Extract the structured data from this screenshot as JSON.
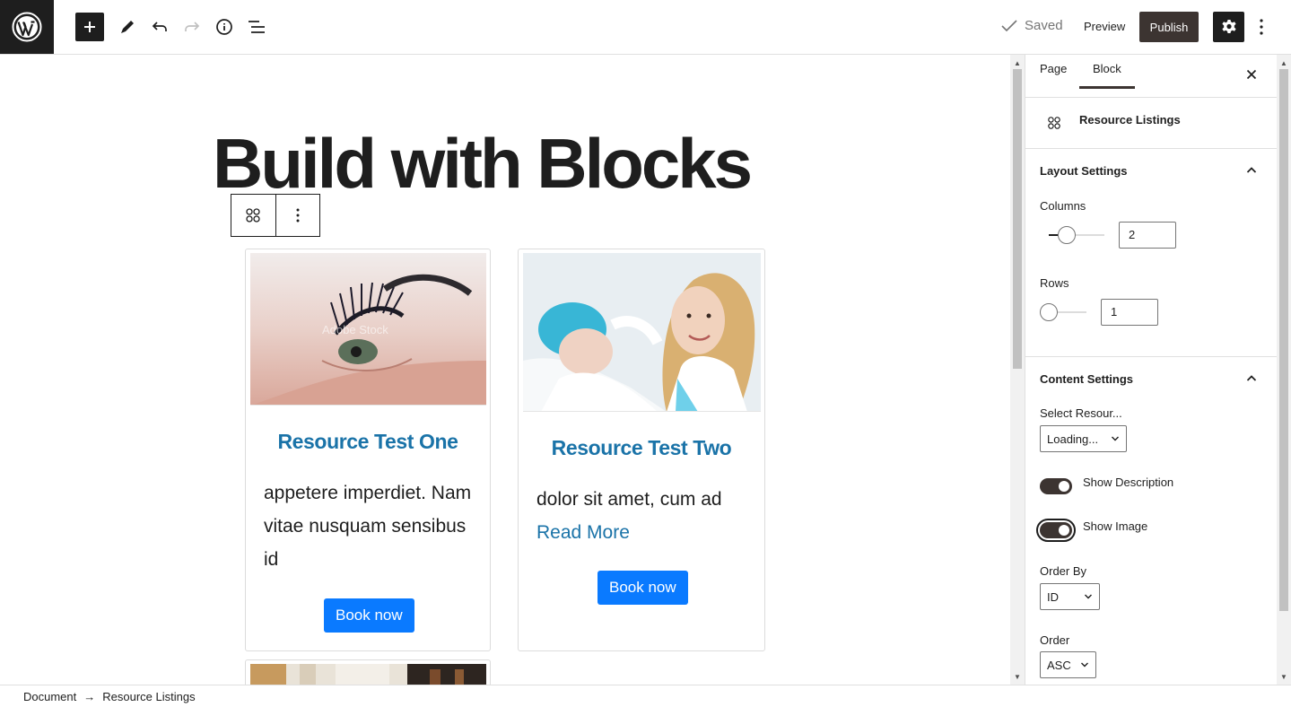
{
  "colors": {
    "accent": "#3c3431",
    "link": "#1a73a8",
    "book_button": "#0a7aff",
    "dark": "#1e1e1e"
  },
  "toolbar": {
    "add_icon": "plus-icon",
    "tools_icon": "pencil-icon",
    "undo_icon": "undo-icon",
    "redo_icon": "redo-icon",
    "details_icon": "info-icon",
    "list_view_icon": "list-view-icon",
    "saved_label": "Saved",
    "preview_label": "Preview",
    "publish_label": "Publish",
    "settings_icon": "gear-icon",
    "options_icon": "more-vertical-icon"
  },
  "editor": {
    "title": "Build with Blocks",
    "cards": [
      {
        "title": "Resource Test One",
        "text": "appetere imperdiet. Nam vitae nusquam sensibus id",
        "link": "",
        "button": "Book now",
        "watermark": "Adobe Stock"
      },
      {
        "title": "Resource Test Two",
        "text": "dolor sit amet, cum ad",
        "link": "Read More",
        "button": "Book now"
      }
    ]
  },
  "sidebar": {
    "tabs": [
      "Page",
      "Block"
    ],
    "active_tab": "Block",
    "block_name": "Resource Listings",
    "layout": {
      "title": "Layout Settings",
      "columns_label": "Columns",
      "columns_value": "2",
      "columns_range": [
        1,
        4
      ],
      "rows_label": "Rows",
      "rows_value": "1",
      "rows_range": [
        1,
        4
      ]
    },
    "content": {
      "title": "Content Settings",
      "select_resource_label": "Select Resour...",
      "select_resource_value": "Loading...",
      "show_description_label": "Show Description",
      "show_description": true,
      "show_image_label": "Show Image",
      "show_image": true,
      "order_by_label": "Order By",
      "order_by_value": "ID",
      "order_label": "Order",
      "order_value": "ASC"
    }
  },
  "footer": {
    "breadcrumb": [
      "Document",
      "Resource Listings"
    ],
    "separator": "→"
  }
}
